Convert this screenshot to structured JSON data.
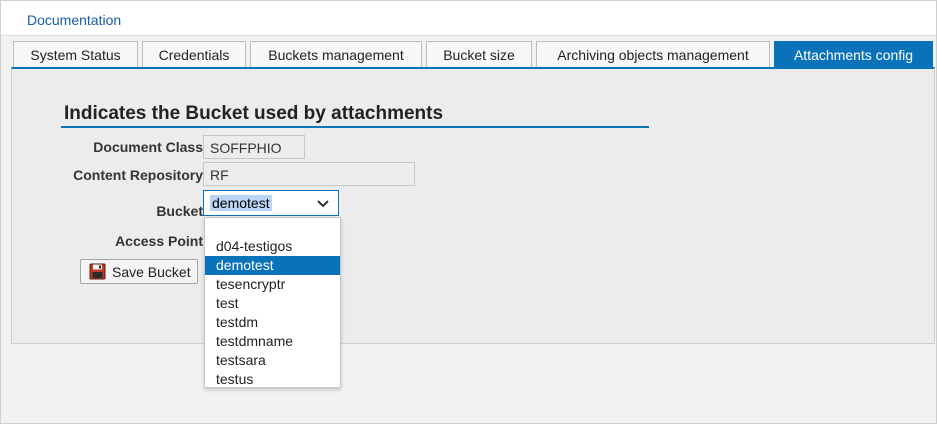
{
  "header": {
    "link_label": "Documentation"
  },
  "tabs": [
    {
      "label": "System Status"
    },
    {
      "label": "Credentials"
    },
    {
      "label": "Buckets management"
    },
    {
      "label": "Bucket size"
    },
    {
      "label": "Archiving objects management"
    },
    {
      "label": "Attachments config",
      "active": true
    }
  ],
  "form": {
    "title": "Indicates the Bucket used by attachments",
    "document_class": {
      "label": "Document Class",
      "value": "SOFFPHIO"
    },
    "content_repository": {
      "label": "Content Repository",
      "value": "RF"
    },
    "bucket": {
      "label": "Bucket",
      "value": "demotest"
    },
    "access_point": {
      "label": "Access Point"
    },
    "save_button": {
      "label": "Save Bucket",
      "icon": "floppy-disk-icon"
    }
  },
  "dropdown": {
    "options": [
      {
        "label": ""
      },
      {
        "label": "d04-testigos"
      },
      {
        "label": "demotest",
        "selected": true
      },
      {
        "label": "tesencryptr"
      },
      {
        "label": "test"
      },
      {
        "label": "testdm"
      },
      {
        "label": "testdmname"
      },
      {
        "label": "testsara"
      },
      {
        "label": "testus"
      }
    ]
  },
  "colors": {
    "accent": "#0a72b9",
    "link": "#1a5ea8"
  }
}
